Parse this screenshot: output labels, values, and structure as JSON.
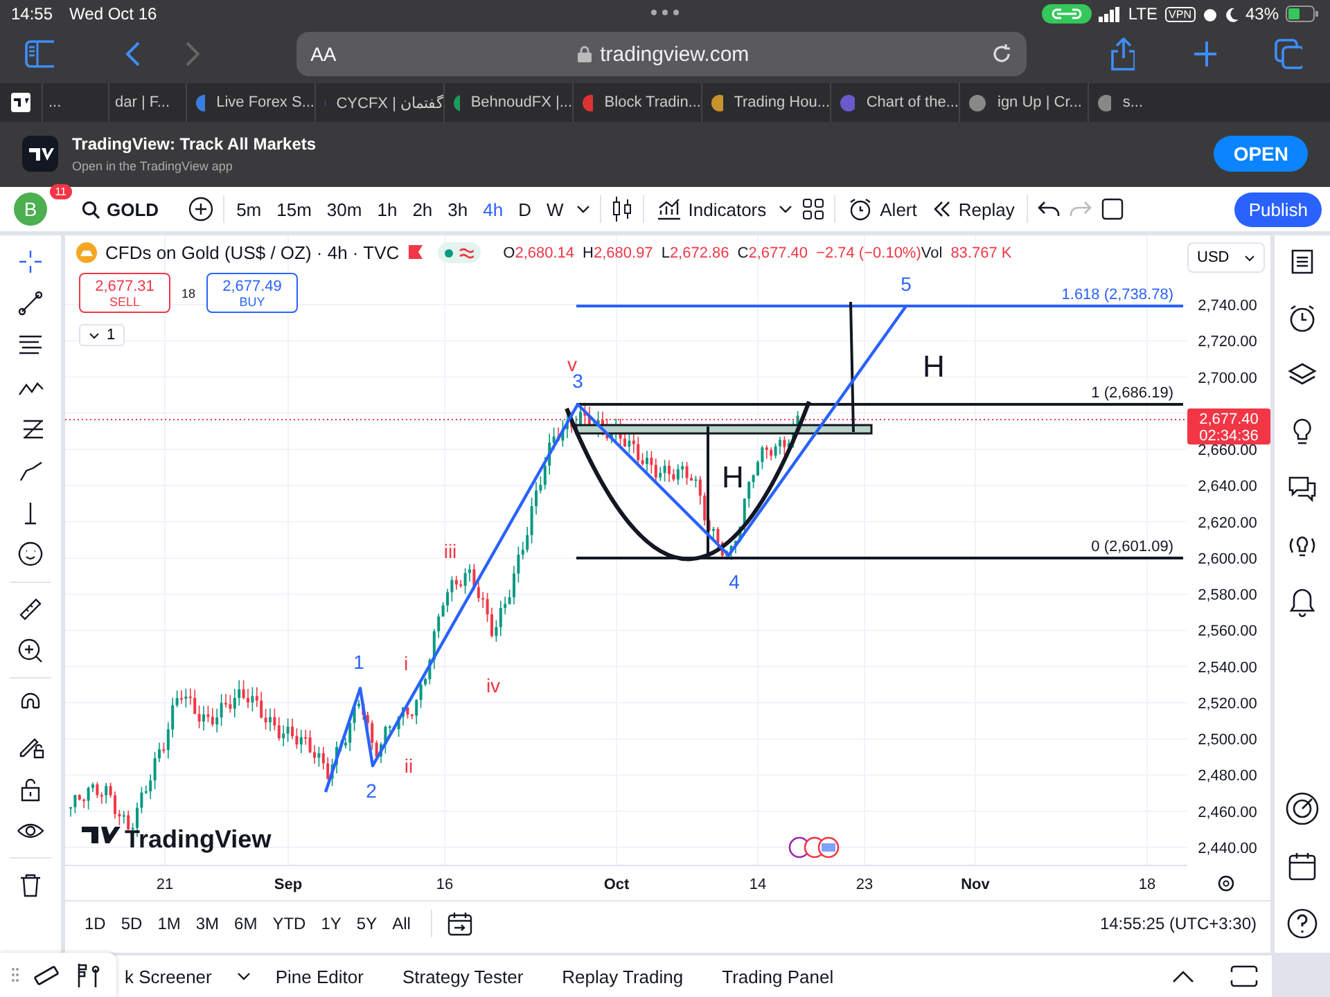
{
  "status_bar": {
    "time": "14:55",
    "date": "Wed Oct 16",
    "network": "LTE",
    "vpn": "VPN",
    "battery": "43%"
  },
  "browser": {
    "text_size": "AA",
    "address": "tradingview.com",
    "forward_disabled": true
  },
  "tabs": [
    {
      "title": "..."
    },
    {
      "title": "dar | F..."
    },
    {
      "title": "Live Forex S..."
    },
    {
      "title": "CYCFX | گفتمان"
    },
    {
      "title": "BehnoudFX |..."
    },
    {
      "title": "Block Tradin..."
    },
    {
      "title": "Trading Hou..."
    },
    {
      "title": "Chart of the..."
    },
    {
      "title": "ign Up | Cr..."
    },
    {
      "title": "s..."
    }
  ],
  "app_banner": {
    "title": "TradingView: Track All Markets",
    "subtitle": "Open in the TradingView app",
    "button": "OPEN"
  },
  "toolbar": {
    "avatar": "B",
    "notifications": "11",
    "symbol": "GOLD",
    "intervals": [
      {
        "label": "5m",
        "selected": false
      },
      {
        "label": "15m",
        "selected": false
      },
      {
        "label": "30m",
        "selected": false
      },
      {
        "label": "1h",
        "selected": false
      },
      {
        "label": "2h",
        "selected": false
      },
      {
        "label": "3h",
        "selected": false
      },
      {
        "label": "4h",
        "selected": true
      },
      {
        "label": "D",
        "selected": false
      },
      {
        "label": "W",
        "selected": false
      }
    ],
    "indicators": "Indicators",
    "alert": "Alert",
    "replay": "Replay",
    "publish": "Publish"
  },
  "legend": {
    "symbol": "CFDs on Gold (US$ / OZ) · 4h · TVC",
    "ohlc": [
      {
        "key": "O",
        "value": "2,680.14"
      },
      {
        "key": "H",
        "value": "2,680.97"
      },
      {
        "key": "L",
        "value": "2,672.86"
      },
      {
        "key": "C",
        "value": "2,677.40"
      }
    ],
    "change": "−2.74 (−0.10%)",
    "volume_key": "Vol",
    "volume": "83.767 K",
    "currency": "USD",
    "sell": {
      "price": "2,677.31",
      "label": "SELL"
    },
    "spread": "18",
    "buy": {
      "price": "2,677.49",
      "label": "BUY"
    },
    "indicator_count": "1"
  },
  "chart": {
    "price_labels": [
      "2,740.00",
      "2,720.00",
      "2,700.00",
      "2,660.00",
      "2,640.00",
      "2,620.00",
      "2,600.00",
      "2,580.00",
      "2,560.00",
      "2,540.00",
      "2,520.00",
      "2,500.00",
      "2,480.00",
      "2,460.00",
      "2,440.00"
    ],
    "time_labels": [
      "21",
      "Sep",
      "16",
      "Oct",
      "14",
      "23",
      "Nov",
      "18"
    ],
    "current_price": "2,677.40",
    "countdown": "02:34:36",
    "fib_levels": [
      {
        "label": "1.618 (2,738.78)",
        "color": "#2962ff"
      },
      {
        "label": "1 (2,686.19)",
        "color": "#131722"
      },
      {
        "label": "0 (2,601.09)",
        "color": "#131722"
      }
    ],
    "wave_labels": [
      {
        "text": "1",
        "color": "#2962ff"
      },
      {
        "text": "2",
        "color": "#2962ff"
      },
      {
        "text": "3",
        "color": "#2962ff"
      },
      {
        "text": "4",
        "color": "#2962ff"
      },
      {
        "text": "5",
        "color": "#2962ff"
      },
      {
        "text": "i",
        "color": "#f23645"
      },
      {
        "text": "ii",
        "color": "#f23645"
      },
      {
        "text": "iii",
        "color": "#f23645"
      },
      {
        "text": "iv",
        "color": "#f23645"
      },
      {
        "text": "v",
        "color": "#f23645"
      }
    ],
    "pattern_labels": [
      "H",
      "H"
    ],
    "watermark_logo": "TradingView"
  },
  "ranges": [
    "1D",
    "5D",
    "1M",
    "3M",
    "6M",
    "YTD",
    "1Y",
    "5Y",
    "All"
  ],
  "clock": "14:55:25 (UTC+3:30)",
  "bottom_tabs": [
    "k Screener",
    "Pine Editor",
    "Strategy Tester",
    "Replay Trading",
    "Trading Panel"
  ]
}
